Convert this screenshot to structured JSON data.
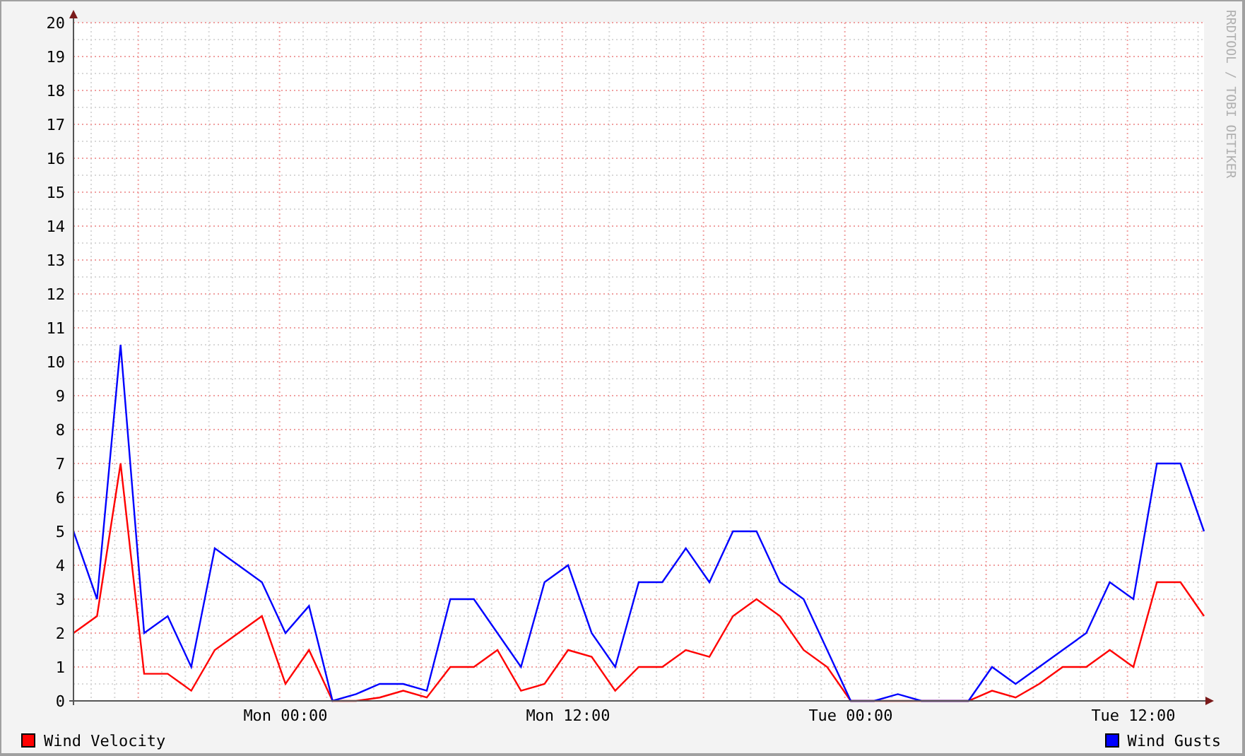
{
  "chart_data": {
    "type": "line",
    "categories": [
      null,
      null,
      null,
      null,
      null,
      null,
      null,
      null,
      null,
      "Mon 00:00",
      null,
      null,
      null,
      null,
      null,
      null,
      null,
      null,
      null,
      null,
      null,
      "Mon 12:00",
      null,
      null,
      null,
      null,
      null,
      null,
      null,
      null,
      null,
      null,
      null,
      "Tue 00:00",
      null,
      null,
      null,
      null,
      null,
      null,
      null,
      null,
      null,
      null,
      null,
      "Tue 12:00",
      null,
      null,
      null
    ],
    "series": [
      {
        "name": "Wind Velocity",
        "color": "#ff0000",
        "values": [
          2,
          2.5,
          7,
          0.8,
          0.8,
          0.3,
          1.5,
          2,
          2.5,
          0.5,
          1.5,
          0,
          0,
          0.1,
          0.3,
          0.1,
          1,
          1,
          1.5,
          0.3,
          0.5,
          1.5,
          1.3,
          0.3,
          1,
          1,
          1.5,
          1.3,
          2.5,
          3,
          2.5,
          1.5,
          1,
          0,
          0,
          0,
          0,
          0,
          0,
          0.3,
          0.1,
          0.5,
          1,
          1,
          1.5,
          1,
          3.5,
          3.5,
          2.5
        ]
      },
      {
        "name": "Wind Gusts",
        "color": "#0000ff",
        "values": [
          5,
          3,
          10.5,
          2,
          2.5,
          1,
          4.5,
          4,
          3.5,
          2,
          2.8,
          0,
          0.2,
          0.5,
          0.5,
          0.3,
          3,
          3,
          2,
          1,
          3.5,
          4,
          2,
          1,
          3.5,
          3.5,
          4.5,
          3.5,
          5,
          5,
          3.5,
          3,
          1.5,
          0,
          0,
          0.2,
          0,
          0,
          0,
          1,
          0.5,
          1,
          1.5,
          2,
          3.5,
          3,
          7,
          7,
          5
        ]
      }
    ],
    "ylim": [
      0,
      20
    ],
    "yticks": [
      0,
      1,
      2,
      3,
      4,
      5,
      6,
      7,
      8,
      9,
      10,
      11,
      12,
      13,
      14,
      15,
      16,
      17,
      18,
      19,
      20
    ],
    "grid": true
  },
  "credit": "RRDTOOL / TOBI OETIKER"
}
